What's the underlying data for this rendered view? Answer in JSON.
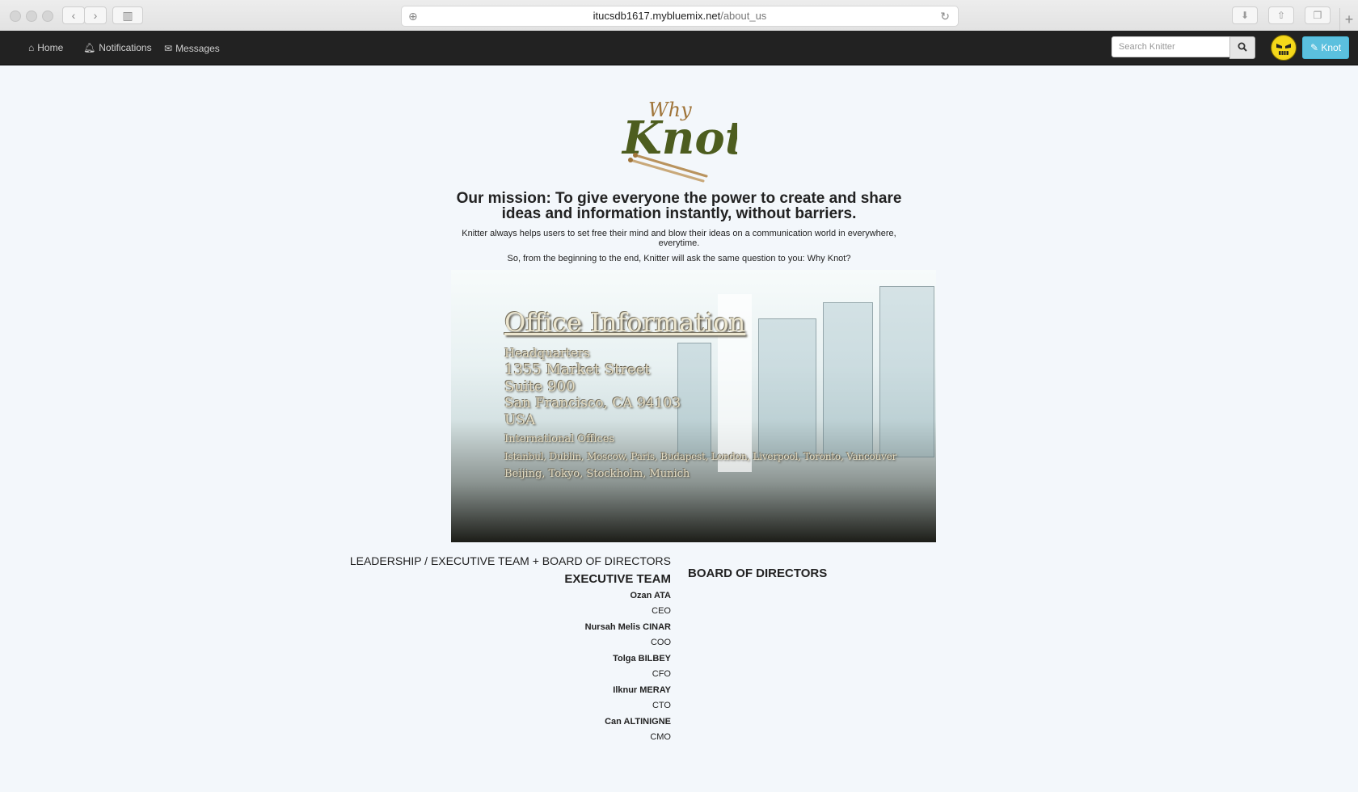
{
  "browser": {
    "url_host": "itucsdb1617.mybluemix.net",
    "url_path": "/about_us"
  },
  "nav": {
    "items": [
      {
        "label": "Home",
        "icon": "home-icon"
      },
      {
        "label": "Notifications",
        "icon": "bell-icon"
      },
      {
        "label": "Messages",
        "icon": "envelope-icon"
      }
    ],
    "search_placeholder": "Search Knitter",
    "knot_button": "Knot"
  },
  "logo": {
    "line1": "Why",
    "line2": "Knot"
  },
  "mission": {
    "title": "Our mission: To give everyone the power to create and share ideas and information instantly, without barriers.",
    "text1": "Knitter always helps users to set free their mind and blow their ideas on a communication world in everywhere, everytime.",
    "text2": "So, from the beginning to the end, Knitter will ask the same question to you: Why Knot?"
  },
  "office": {
    "title": "Office Information",
    "headquarters_label": "Headquarters",
    "address1": "1355 Market Street",
    "address2": "Suite 900",
    "address3": "San Francisco, CA 94103",
    "country": "USA",
    "intl_label": "International Offices",
    "intl_line1": "Istanbul, Dublin, Moscow, Paris, Budapest, London, Liverpool, Toronto, Vancouver",
    "intl_line2": "Beijing, Tokyo, Stockholm, Munich"
  },
  "leadership": {
    "heading": "LEADERSHIP / EXECUTIVE TEAM + BOARD OF DIRECTORS",
    "executive_heading": "EXECUTIVE TEAM",
    "board_heading": "BOARD OF DIRECTORS",
    "members": [
      {
        "name": "Ozan ATA",
        "role": "CEO"
      },
      {
        "name": "Nursah Melis CINAR",
        "role": "COO"
      },
      {
        "name": "Tolga BILBEY",
        "role": "CFO"
      },
      {
        "name": "Ilknur MERAY",
        "role": "CTO"
      },
      {
        "name": "Can ALTINIGNE",
        "role": "CMO"
      }
    ]
  }
}
